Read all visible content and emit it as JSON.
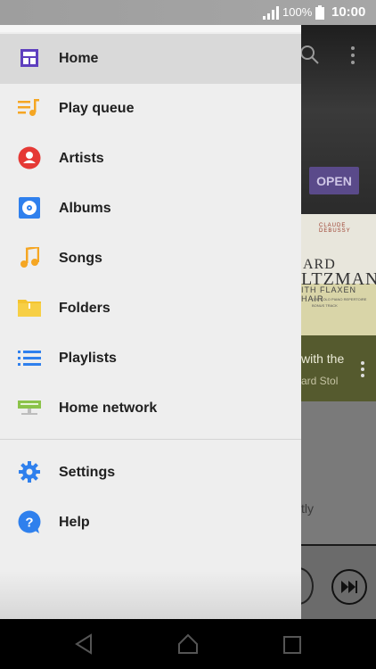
{
  "status_bar": {
    "battery_percent": "100%",
    "time": "10:00"
  },
  "drawer": {
    "items": [
      {
        "label": "Home",
        "icon": "home-icon",
        "active": true
      },
      {
        "label": "Play queue",
        "icon": "play-queue-icon"
      },
      {
        "label": "Artists",
        "icon": "artists-icon"
      },
      {
        "label": "Albums",
        "icon": "albums-icon"
      },
      {
        "label": "Songs",
        "icon": "songs-icon"
      },
      {
        "label": "Folders",
        "icon": "folders-icon"
      },
      {
        "label": "Playlists",
        "icon": "playlists-icon"
      },
      {
        "label": "Home network",
        "icon": "home-network-icon"
      }
    ],
    "secondary_items": [
      {
        "label": "Settings",
        "icon": "settings-icon"
      },
      {
        "label": "Help",
        "icon": "help-icon"
      }
    ]
  },
  "background": {
    "open_button_label": "OPEN",
    "album_small": "CLAUDE DEBUSSY",
    "album_title_1": "ARD",
    "album_title_2": "LTZMAN",
    "album_title_3": "ITH FLAXEN HAIR",
    "album_line_4": "ORE SOLO PIANO REPERTOIRE",
    "album_line_5": "BONUS TRACK",
    "now_playing_track": "with the",
    "now_playing_artist": "ard Stol",
    "list_text": "tly"
  },
  "colors": {
    "accent_purple": "#6a4bbf",
    "orange": "#f5a623",
    "red": "#e53935",
    "blue": "#2f80ed",
    "folder_yellow": "#f4c430",
    "green": "#8bc34a"
  }
}
